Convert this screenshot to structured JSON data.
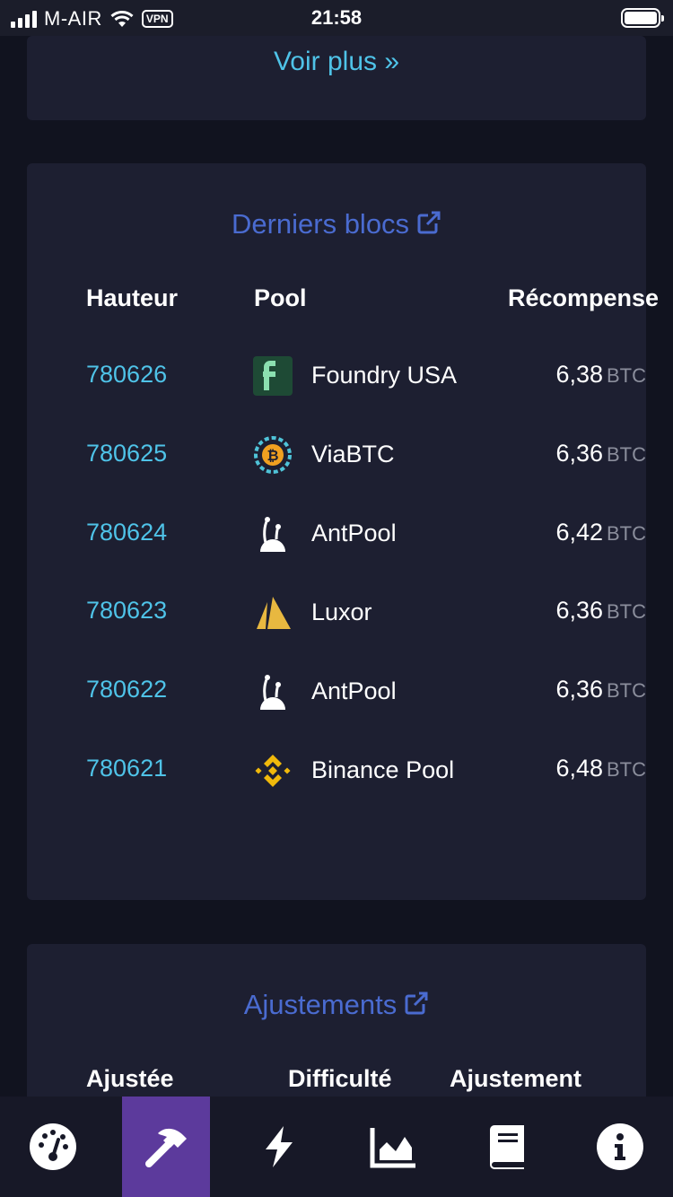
{
  "status_bar": {
    "carrier": "M-AIR",
    "vpn": "VPN",
    "time": "21:58"
  },
  "top_card": {
    "more_link": "Voir plus »"
  },
  "blocks_card": {
    "title": "Derniers blocs",
    "headers": {
      "height": "Hauteur",
      "pool": "Pool",
      "reward": "Récompense"
    },
    "rows": [
      {
        "height": "780626",
        "pool": "Foundry USA",
        "logo": "foundry-usa-logo",
        "reward": "6,38",
        "unit": "BTC"
      },
      {
        "height": "780625",
        "pool": "ViaBTC",
        "logo": "viabtc-logo",
        "reward": "6,36",
        "unit": "BTC"
      },
      {
        "height": "780624",
        "pool": "AntPool",
        "logo": "antpool-logo",
        "reward": "6,42",
        "unit": "BTC"
      },
      {
        "height": "780623",
        "pool": "Luxor",
        "logo": "luxor-logo",
        "reward": "6,36",
        "unit": "BTC"
      },
      {
        "height": "780622",
        "pool": "AntPool",
        "logo": "antpool-logo",
        "reward": "6,36",
        "unit": "BTC"
      },
      {
        "height": "780621",
        "pool": "Binance Pool",
        "logo": "binance-pool-logo",
        "reward": "6,48",
        "unit": "BTC"
      }
    ]
  },
  "adjust_card": {
    "title": "Ajustements",
    "headers": {
      "adjusted": "Ajustée",
      "difficulty": "Difficulté",
      "adjustment": "Ajustement"
    }
  },
  "bottom_nav": {
    "items": [
      {
        "name": "dashboard",
        "icon": "dashboard-gauge-icon",
        "active": false
      },
      {
        "name": "mining",
        "icon": "hammer-icon",
        "active": true
      },
      {
        "name": "lightning",
        "icon": "lightning-icon",
        "active": false
      },
      {
        "name": "graphs",
        "icon": "area-chart-icon",
        "active": false
      },
      {
        "name": "docs",
        "icon": "book-icon",
        "active": false
      },
      {
        "name": "about",
        "icon": "info-icon",
        "active": false
      }
    ]
  },
  "colors": {
    "background": "#11131f",
    "card": "#1d1f31",
    "link": "#4fc3e8",
    "title": "#4a6bd0",
    "active_nav": "#5c3a9c"
  }
}
